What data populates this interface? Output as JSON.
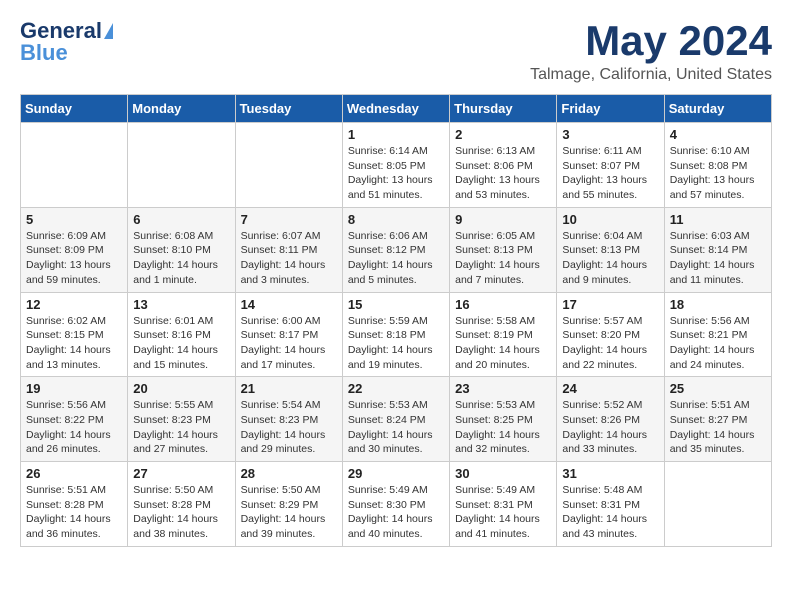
{
  "header": {
    "logo_line1": "General",
    "logo_line2": "Blue",
    "month": "May 2024",
    "location": "Talmage, California, United States"
  },
  "weekdays": [
    "Sunday",
    "Monday",
    "Tuesday",
    "Wednesday",
    "Thursday",
    "Friday",
    "Saturday"
  ],
  "weeks": [
    [
      {
        "day": "",
        "info": ""
      },
      {
        "day": "",
        "info": ""
      },
      {
        "day": "",
        "info": ""
      },
      {
        "day": "1",
        "info": "Sunrise: 6:14 AM\nSunset: 8:05 PM\nDaylight: 13 hours\nand 51 minutes."
      },
      {
        "day": "2",
        "info": "Sunrise: 6:13 AM\nSunset: 8:06 PM\nDaylight: 13 hours\nand 53 minutes."
      },
      {
        "day": "3",
        "info": "Sunrise: 6:11 AM\nSunset: 8:07 PM\nDaylight: 13 hours\nand 55 minutes."
      },
      {
        "day": "4",
        "info": "Sunrise: 6:10 AM\nSunset: 8:08 PM\nDaylight: 13 hours\nand 57 minutes."
      }
    ],
    [
      {
        "day": "5",
        "info": "Sunrise: 6:09 AM\nSunset: 8:09 PM\nDaylight: 13 hours\nand 59 minutes."
      },
      {
        "day": "6",
        "info": "Sunrise: 6:08 AM\nSunset: 8:10 PM\nDaylight: 14 hours\nand 1 minute."
      },
      {
        "day": "7",
        "info": "Sunrise: 6:07 AM\nSunset: 8:11 PM\nDaylight: 14 hours\nand 3 minutes."
      },
      {
        "day": "8",
        "info": "Sunrise: 6:06 AM\nSunset: 8:12 PM\nDaylight: 14 hours\nand 5 minutes."
      },
      {
        "day": "9",
        "info": "Sunrise: 6:05 AM\nSunset: 8:13 PM\nDaylight: 14 hours\nand 7 minutes."
      },
      {
        "day": "10",
        "info": "Sunrise: 6:04 AM\nSunset: 8:13 PM\nDaylight: 14 hours\nand 9 minutes."
      },
      {
        "day": "11",
        "info": "Sunrise: 6:03 AM\nSunset: 8:14 PM\nDaylight: 14 hours\nand 11 minutes."
      }
    ],
    [
      {
        "day": "12",
        "info": "Sunrise: 6:02 AM\nSunset: 8:15 PM\nDaylight: 14 hours\nand 13 minutes."
      },
      {
        "day": "13",
        "info": "Sunrise: 6:01 AM\nSunset: 8:16 PM\nDaylight: 14 hours\nand 15 minutes."
      },
      {
        "day": "14",
        "info": "Sunrise: 6:00 AM\nSunset: 8:17 PM\nDaylight: 14 hours\nand 17 minutes."
      },
      {
        "day": "15",
        "info": "Sunrise: 5:59 AM\nSunset: 8:18 PM\nDaylight: 14 hours\nand 19 minutes."
      },
      {
        "day": "16",
        "info": "Sunrise: 5:58 AM\nSunset: 8:19 PM\nDaylight: 14 hours\nand 20 minutes."
      },
      {
        "day": "17",
        "info": "Sunrise: 5:57 AM\nSunset: 8:20 PM\nDaylight: 14 hours\nand 22 minutes."
      },
      {
        "day": "18",
        "info": "Sunrise: 5:56 AM\nSunset: 8:21 PM\nDaylight: 14 hours\nand 24 minutes."
      }
    ],
    [
      {
        "day": "19",
        "info": "Sunrise: 5:56 AM\nSunset: 8:22 PM\nDaylight: 14 hours\nand 26 minutes."
      },
      {
        "day": "20",
        "info": "Sunrise: 5:55 AM\nSunset: 8:23 PM\nDaylight: 14 hours\nand 27 minutes."
      },
      {
        "day": "21",
        "info": "Sunrise: 5:54 AM\nSunset: 8:23 PM\nDaylight: 14 hours\nand 29 minutes."
      },
      {
        "day": "22",
        "info": "Sunrise: 5:53 AM\nSunset: 8:24 PM\nDaylight: 14 hours\nand 30 minutes."
      },
      {
        "day": "23",
        "info": "Sunrise: 5:53 AM\nSunset: 8:25 PM\nDaylight: 14 hours\nand 32 minutes."
      },
      {
        "day": "24",
        "info": "Sunrise: 5:52 AM\nSunset: 8:26 PM\nDaylight: 14 hours\nand 33 minutes."
      },
      {
        "day": "25",
        "info": "Sunrise: 5:51 AM\nSunset: 8:27 PM\nDaylight: 14 hours\nand 35 minutes."
      }
    ],
    [
      {
        "day": "26",
        "info": "Sunrise: 5:51 AM\nSunset: 8:28 PM\nDaylight: 14 hours\nand 36 minutes."
      },
      {
        "day": "27",
        "info": "Sunrise: 5:50 AM\nSunset: 8:28 PM\nDaylight: 14 hours\nand 38 minutes."
      },
      {
        "day": "28",
        "info": "Sunrise: 5:50 AM\nSunset: 8:29 PM\nDaylight: 14 hours\nand 39 minutes."
      },
      {
        "day": "29",
        "info": "Sunrise: 5:49 AM\nSunset: 8:30 PM\nDaylight: 14 hours\nand 40 minutes."
      },
      {
        "day": "30",
        "info": "Sunrise: 5:49 AM\nSunset: 8:31 PM\nDaylight: 14 hours\nand 41 minutes."
      },
      {
        "day": "31",
        "info": "Sunrise: 5:48 AM\nSunset: 8:31 PM\nDaylight: 14 hours\nand 43 minutes."
      },
      {
        "day": "",
        "info": ""
      }
    ]
  ]
}
